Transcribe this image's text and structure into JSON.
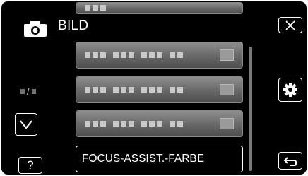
{
  "header": {
    "mode_icon": "camera-icon",
    "title": "BILD"
  },
  "buttons": {
    "close_icon": "close-icon",
    "settings_icon": "gear-icon",
    "down_icon": "chevron-down-icon",
    "help_label": "?",
    "back_icon": "return-arrow-icon"
  },
  "page_indicator": {
    "separator": "/"
  },
  "menu": {
    "items": [
      {
        "label": "",
        "value": "",
        "obscured": true
      },
      {
        "label": "",
        "value": "",
        "obscured": true
      },
      {
        "label": "",
        "value": "",
        "obscured": true
      },
      {
        "label": "",
        "value": "",
        "obscured": true
      },
      {
        "label": "FOCUS-ASSIST.-FARBE",
        "selected": true
      }
    ]
  }
}
